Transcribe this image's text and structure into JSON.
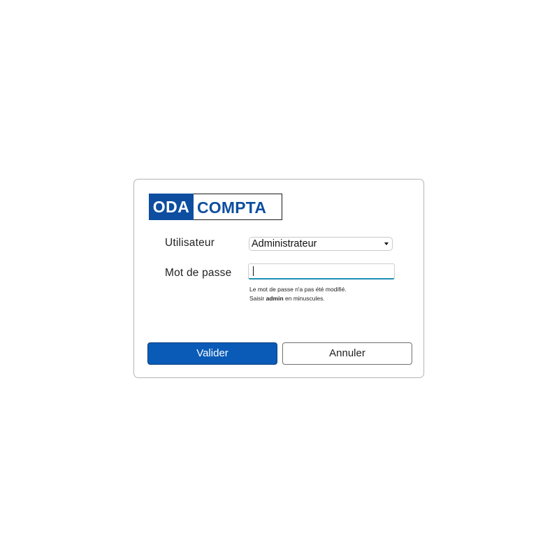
{
  "logo": {
    "left_text": "ODA",
    "right_text": "COMPTA",
    "brand_color": "#0e4ea0"
  },
  "form": {
    "user_label": "Utilisateur",
    "user_value": "Administrateur",
    "password_label": "Mot de passe",
    "password_value": "",
    "hint_line1": "Le mot de passe n'a pas été modifié.",
    "hint_line2_prefix": "Saisir ",
    "hint_line2_bold": "admin",
    "hint_line2_suffix": " en minuscules."
  },
  "buttons": {
    "ok_label": "Valider",
    "cancel_label": "Annuler",
    "ok_color": "#0a5bb8"
  },
  "icons": {
    "select_arrow": "dropdown-arrow-icon"
  }
}
